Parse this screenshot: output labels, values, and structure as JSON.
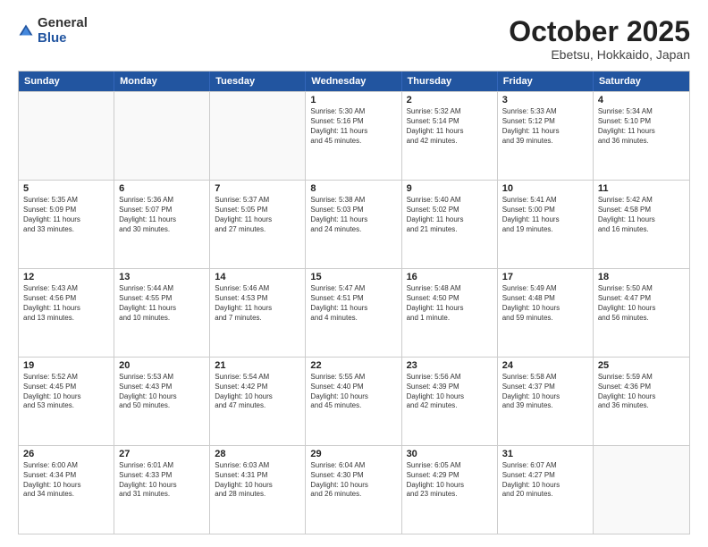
{
  "logo": {
    "general": "General",
    "blue": "Blue"
  },
  "title": "October 2025",
  "subtitle": "Ebetsu, Hokkaido, Japan",
  "headers": [
    "Sunday",
    "Monday",
    "Tuesday",
    "Wednesday",
    "Thursday",
    "Friday",
    "Saturday"
  ],
  "weeks": [
    [
      {
        "day": "",
        "info": "",
        "empty": true
      },
      {
        "day": "",
        "info": "",
        "empty": true
      },
      {
        "day": "",
        "info": "",
        "empty": true
      },
      {
        "day": "1",
        "info": "Sunrise: 5:30 AM\nSunset: 5:16 PM\nDaylight: 11 hours\nand 45 minutes."
      },
      {
        "day": "2",
        "info": "Sunrise: 5:32 AM\nSunset: 5:14 PM\nDaylight: 11 hours\nand 42 minutes."
      },
      {
        "day": "3",
        "info": "Sunrise: 5:33 AM\nSunset: 5:12 PM\nDaylight: 11 hours\nand 39 minutes."
      },
      {
        "day": "4",
        "info": "Sunrise: 5:34 AM\nSunset: 5:10 PM\nDaylight: 11 hours\nand 36 minutes."
      }
    ],
    [
      {
        "day": "5",
        "info": "Sunrise: 5:35 AM\nSunset: 5:09 PM\nDaylight: 11 hours\nand 33 minutes."
      },
      {
        "day": "6",
        "info": "Sunrise: 5:36 AM\nSunset: 5:07 PM\nDaylight: 11 hours\nand 30 minutes."
      },
      {
        "day": "7",
        "info": "Sunrise: 5:37 AM\nSunset: 5:05 PM\nDaylight: 11 hours\nand 27 minutes."
      },
      {
        "day": "8",
        "info": "Sunrise: 5:38 AM\nSunset: 5:03 PM\nDaylight: 11 hours\nand 24 minutes."
      },
      {
        "day": "9",
        "info": "Sunrise: 5:40 AM\nSunset: 5:02 PM\nDaylight: 11 hours\nand 21 minutes."
      },
      {
        "day": "10",
        "info": "Sunrise: 5:41 AM\nSunset: 5:00 PM\nDaylight: 11 hours\nand 19 minutes."
      },
      {
        "day": "11",
        "info": "Sunrise: 5:42 AM\nSunset: 4:58 PM\nDaylight: 11 hours\nand 16 minutes."
      }
    ],
    [
      {
        "day": "12",
        "info": "Sunrise: 5:43 AM\nSunset: 4:56 PM\nDaylight: 11 hours\nand 13 minutes."
      },
      {
        "day": "13",
        "info": "Sunrise: 5:44 AM\nSunset: 4:55 PM\nDaylight: 11 hours\nand 10 minutes."
      },
      {
        "day": "14",
        "info": "Sunrise: 5:46 AM\nSunset: 4:53 PM\nDaylight: 11 hours\nand 7 minutes."
      },
      {
        "day": "15",
        "info": "Sunrise: 5:47 AM\nSunset: 4:51 PM\nDaylight: 11 hours\nand 4 minutes."
      },
      {
        "day": "16",
        "info": "Sunrise: 5:48 AM\nSunset: 4:50 PM\nDaylight: 11 hours\nand 1 minute."
      },
      {
        "day": "17",
        "info": "Sunrise: 5:49 AM\nSunset: 4:48 PM\nDaylight: 10 hours\nand 59 minutes."
      },
      {
        "day": "18",
        "info": "Sunrise: 5:50 AM\nSunset: 4:47 PM\nDaylight: 10 hours\nand 56 minutes."
      }
    ],
    [
      {
        "day": "19",
        "info": "Sunrise: 5:52 AM\nSunset: 4:45 PM\nDaylight: 10 hours\nand 53 minutes."
      },
      {
        "day": "20",
        "info": "Sunrise: 5:53 AM\nSunset: 4:43 PM\nDaylight: 10 hours\nand 50 minutes."
      },
      {
        "day": "21",
        "info": "Sunrise: 5:54 AM\nSunset: 4:42 PM\nDaylight: 10 hours\nand 47 minutes."
      },
      {
        "day": "22",
        "info": "Sunrise: 5:55 AM\nSunset: 4:40 PM\nDaylight: 10 hours\nand 45 minutes."
      },
      {
        "day": "23",
        "info": "Sunrise: 5:56 AM\nSunset: 4:39 PM\nDaylight: 10 hours\nand 42 minutes."
      },
      {
        "day": "24",
        "info": "Sunrise: 5:58 AM\nSunset: 4:37 PM\nDaylight: 10 hours\nand 39 minutes."
      },
      {
        "day": "25",
        "info": "Sunrise: 5:59 AM\nSunset: 4:36 PM\nDaylight: 10 hours\nand 36 minutes."
      }
    ],
    [
      {
        "day": "26",
        "info": "Sunrise: 6:00 AM\nSunset: 4:34 PM\nDaylight: 10 hours\nand 34 minutes."
      },
      {
        "day": "27",
        "info": "Sunrise: 6:01 AM\nSunset: 4:33 PM\nDaylight: 10 hours\nand 31 minutes."
      },
      {
        "day": "28",
        "info": "Sunrise: 6:03 AM\nSunset: 4:31 PM\nDaylight: 10 hours\nand 28 minutes."
      },
      {
        "day": "29",
        "info": "Sunrise: 6:04 AM\nSunset: 4:30 PM\nDaylight: 10 hours\nand 26 minutes."
      },
      {
        "day": "30",
        "info": "Sunrise: 6:05 AM\nSunset: 4:29 PM\nDaylight: 10 hours\nand 23 minutes."
      },
      {
        "day": "31",
        "info": "Sunrise: 6:07 AM\nSunset: 4:27 PM\nDaylight: 10 hours\nand 20 minutes."
      },
      {
        "day": "",
        "info": "",
        "empty": true
      }
    ]
  ]
}
